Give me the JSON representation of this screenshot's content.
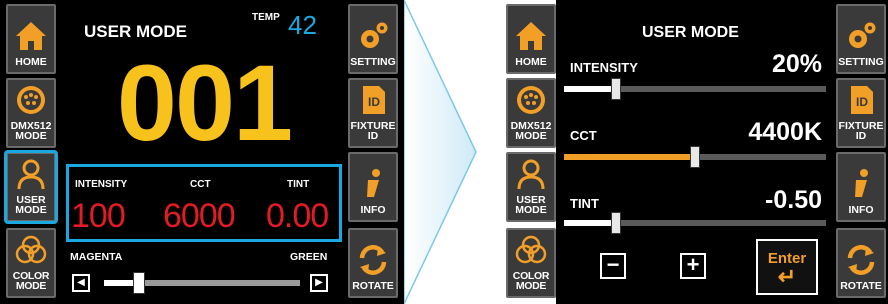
{
  "nav_left": [
    {
      "label": "HOME",
      "icon": "home-icon"
    },
    {
      "label": "DMX512\nMODE",
      "icon": "dmx-connector-icon"
    },
    {
      "label": "USER\nMODE",
      "icon": "user-icon",
      "active": true
    },
    {
      "label": "COLOR\nMODE",
      "icon": "color-circles-icon"
    }
  ],
  "nav_right": [
    {
      "label": "SETTING",
      "icon": "gears-icon"
    },
    {
      "label": "FIXTURE\nID",
      "icon": "id-card-icon"
    },
    {
      "label": "INFO",
      "icon": "info-icon"
    },
    {
      "label": "ROTATE",
      "icon": "rotate-icon"
    }
  ],
  "main": {
    "title": "USER MODE",
    "temp_label": "TEMP",
    "temp_value": "42",
    "mode_number": "001",
    "params": [
      {
        "label": "INTENSITY",
        "value": "100"
      },
      {
        "label": "CCT",
        "value": "6000"
      },
      {
        "label": "TINT",
        "value": "0.00"
      }
    ],
    "tint_slider": {
      "left_label": "MAGENTA",
      "right_label": "GREEN",
      "level": 0.18
    }
  },
  "detail": {
    "title": "USER MODE",
    "sliders": [
      {
        "label": "INTENSITY",
        "value": "20%",
        "level": 0.2,
        "fill_color": "#ffffff"
      },
      {
        "label": "CCT",
        "value": "4400K",
        "level": 0.5,
        "fill_color": "#f29f28"
      },
      {
        "label": "TINT",
        "value": "-0.50",
        "level": 0.2,
        "fill_color": "#ffffff"
      }
    ],
    "minus_label": "−",
    "plus_label": "+",
    "enter_label": "Enter"
  },
  "colors": {
    "highlight": "#1aa8e0",
    "mode_number": "#f6c21b",
    "param_value": "#e31b23",
    "accent_orange": "#f29f28",
    "icon_orange": "#f29f28"
  }
}
